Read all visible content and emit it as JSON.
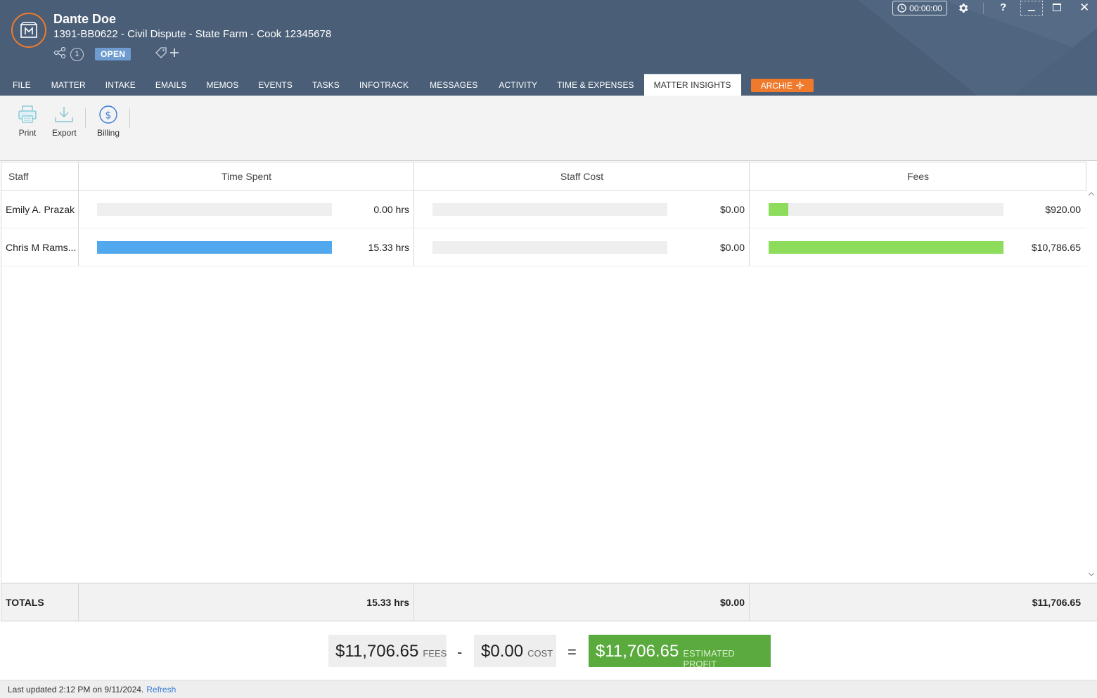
{
  "header": {
    "client_name": "Dante Doe",
    "matter_line": "1391-BB0622 - Civil Dispute - State Farm - Cook 12345678",
    "related_count": "1",
    "status": "OPEN",
    "timer": "00:00:00",
    "help": "?",
    "close": "✕"
  },
  "tabs": [
    {
      "label": "FILE"
    },
    {
      "label": "MATTER"
    },
    {
      "label": "INTAKE"
    },
    {
      "label": "EMAILS"
    },
    {
      "label": "MEMOS"
    },
    {
      "label": "EVENTS"
    },
    {
      "label": "TASKS"
    },
    {
      "label": "INFOTRACK"
    },
    {
      "label": "MESSAGES"
    },
    {
      "label": "ACTIVITY"
    },
    {
      "label": "TIME & EXPENSES"
    },
    {
      "label": "MATTER INSIGHTS"
    }
  ],
  "archie_label": "ARCHIE",
  "toolbar": {
    "print_label": "Print",
    "export_label": "Export",
    "billing_label": "Billing"
  },
  "grid": {
    "columns": {
      "staff": "Staff",
      "time_spent": "Time Spent",
      "staff_cost": "Staff Cost",
      "fees": "Fees"
    },
    "rows": [
      {
        "staff": "Emily A. Prazak",
        "time": "0.00 hrs",
        "time_fraction": 0,
        "cost": "$0.00",
        "cost_fraction": 0,
        "fees": "$920.00",
        "fees_fraction": 0.0853
      },
      {
        "staff": "Chris M Rams...",
        "time": "15.33 hrs",
        "time_fraction": 1,
        "cost": "$0.00",
        "cost_fraction": 0,
        "fees": "$10,786.65",
        "fees_fraction": 1
      }
    ],
    "totals": {
      "label": "TOTALS",
      "time": "15.33 hrs",
      "cost": "$0.00",
      "fees": "$11,706.65"
    }
  },
  "summary": {
    "fees_amount": "$11,706.65",
    "fees_label": "FEES",
    "minus": "-",
    "cost_amount": "$0.00",
    "cost_label": "COST",
    "equals": "=",
    "profit_amount": "$11,706.65",
    "profit_label": "ESTIMATED PROFIT"
  },
  "footer": {
    "last_updated": "Last updated 2:12 PM on 9/11/2024.",
    "refresh_label": "Refresh"
  },
  "colors": {
    "header_bg": "#4a5e77",
    "accent_orange": "#f07a2b",
    "time_bar": "#52a8ee",
    "fees_bar": "#8ddc5b",
    "profit_bg": "#5aaa3e"
  }
}
